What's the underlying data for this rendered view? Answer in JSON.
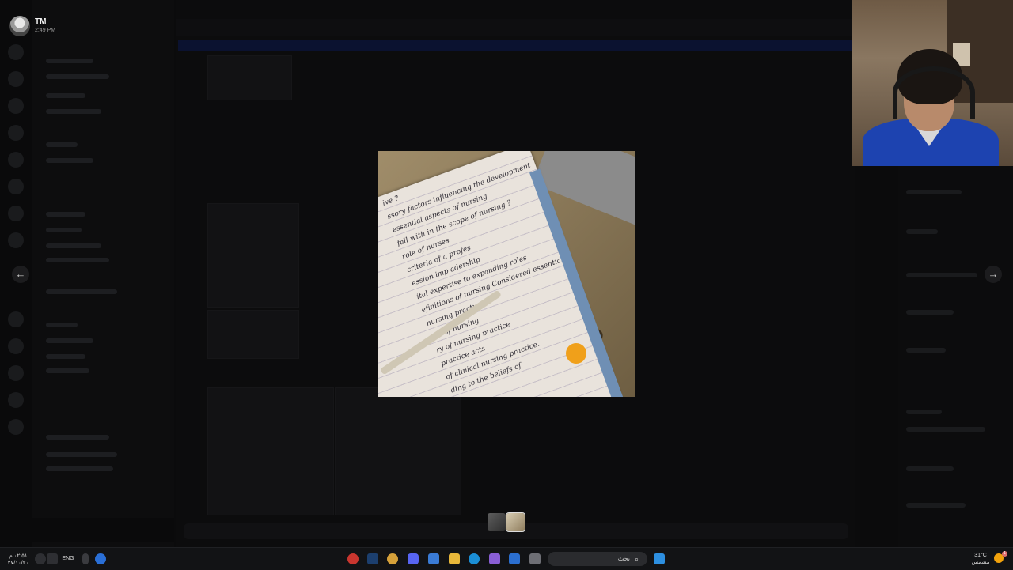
{
  "viewer": {
    "username": "TM",
    "timestamp": "2:49 PM",
    "prev_label": "←",
    "next_label": "→"
  },
  "image": {
    "handwriting": [
      "ive ?",
      "ssory factors influencing the development",
      "essential aspects of nursing",
      "fall with in the scope of nursing ?",
      "role of nurses",
      "criteria of a profes",
      "ession imp     adership",
      "      ital expertise to expanding roles",
      "efinitions of nursing  Considered essential",
      "nursing practice?",
      "nts of nursing",
      "ry of nursing practice",
      "practice acts",
      "of clinical nursing practice.",
      "ding to the beliefs of"
    ]
  },
  "taskbar": {
    "time": "٠٢:٥١ م",
    "date": "٢٧/١٠/٢٠",
    "language": "ENG",
    "search_placeholder": "بحث",
    "search_glyph": "⌕",
    "weather_temp": "31°C",
    "weather_desc": "مشمس",
    "weather_badge": "1"
  },
  "colors": {
    "accent": "#5865f2",
    "overlay": "#050505",
    "taskbar": "#121315"
  }
}
